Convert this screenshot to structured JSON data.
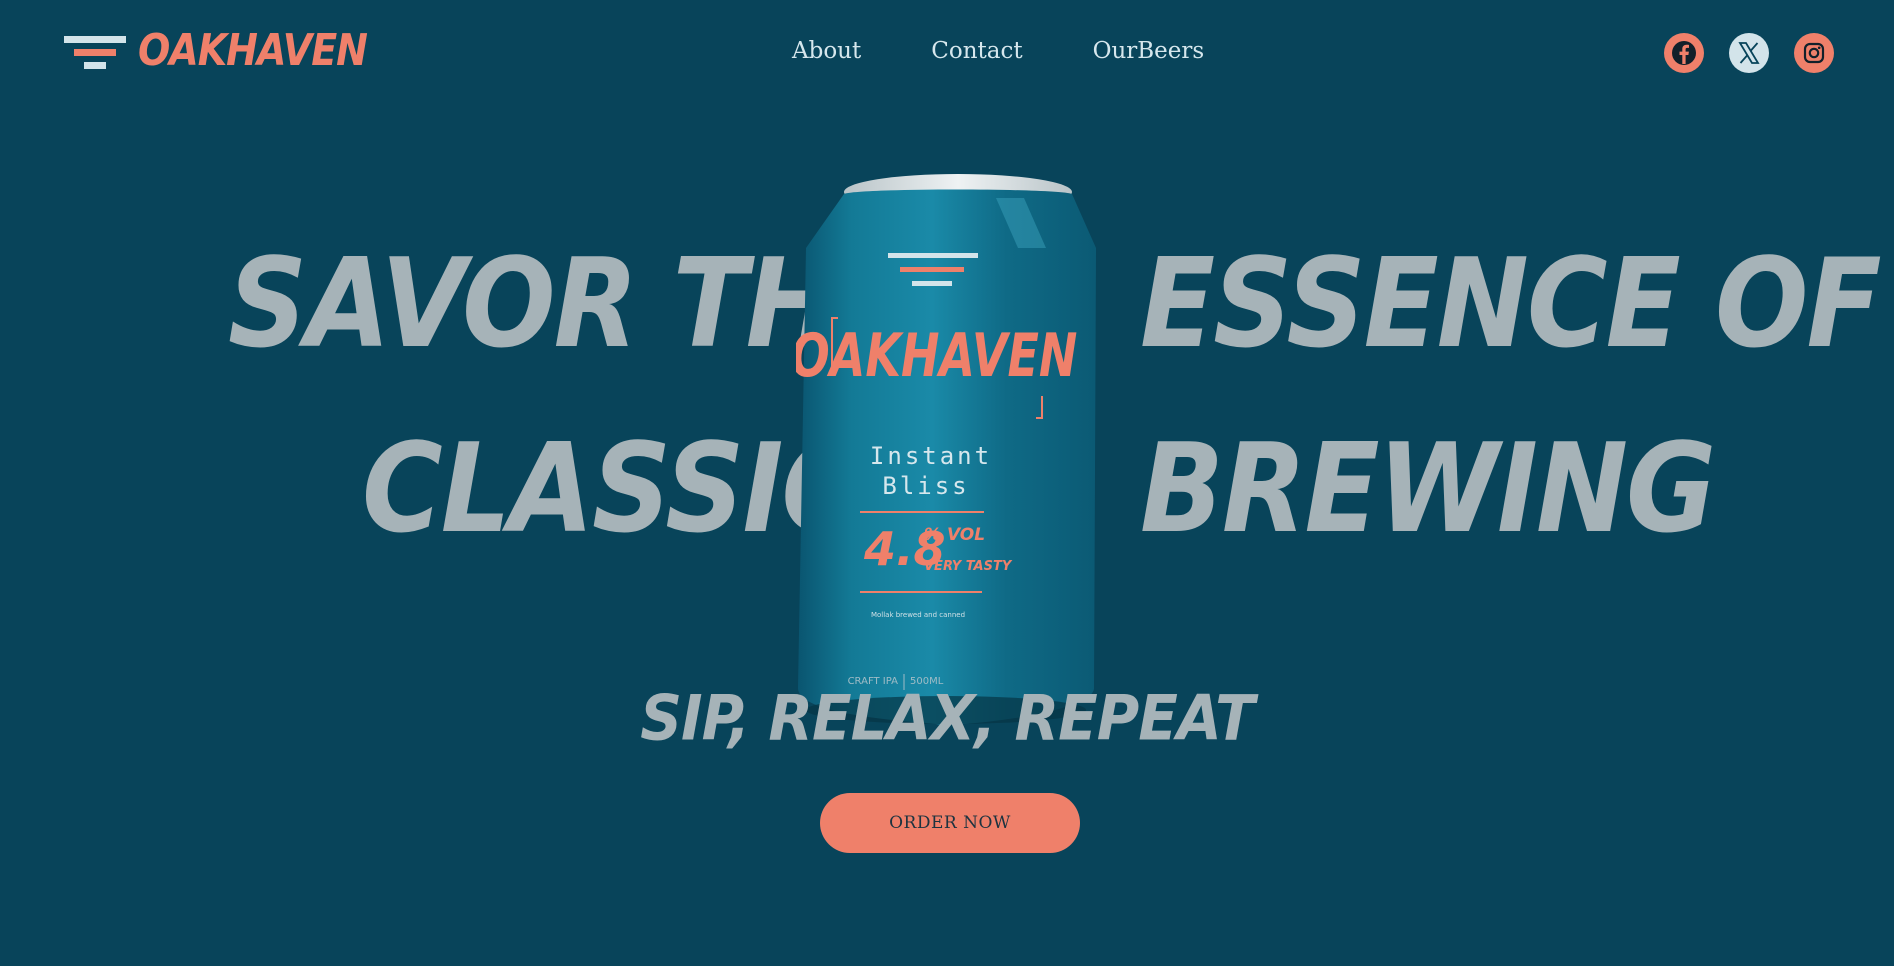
{
  "brand": {
    "name": "OAKHAVEN",
    "accent_color": "#ef806a",
    "background_color": "#08445a"
  },
  "nav": {
    "items": [
      {
        "label": "About"
      },
      {
        "label": "Contact"
      },
      {
        "label": "OurBeers"
      }
    ]
  },
  "social": {
    "items": [
      {
        "icon": "facebook-icon"
      },
      {
        "icon": "x-twitter-icon"
      },
      {
        "icon": "instagram-icon"
      }
    ]
  },
  "hero": {
    "line1_left": "SAVOR THE",
    "line1_right": "ESSENCE OF",
    "line2_left": "CLASSIC",
    "line2_right": "BREWING",
    "tagline": "SIP, RELAX, REPEAT",
    "cta_label": "ORDER NOW"
  },
  "can": {
    "brand": "OAKHAVEN",
    "name_line1": "Instant",
    "name_line2": "Bliss",
    "abv": "4.8",
    "abv_unit": "% VOL",
    "descriptor": "VERY TASTY",
    "note": "Mollak brewed and canned",
    "style": "CRAFT IPA",
    "volume": "500ML"
  }
}
